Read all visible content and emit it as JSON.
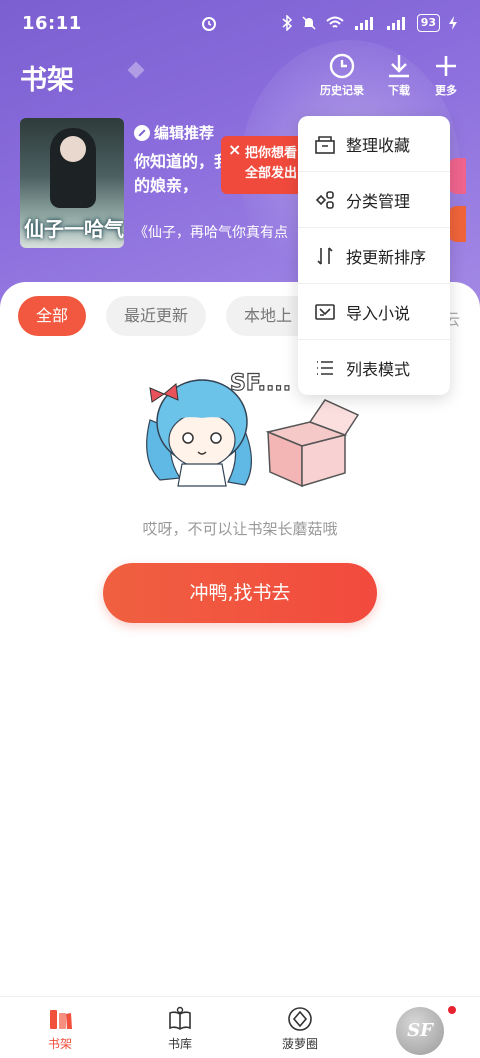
{
  "status": {
    "time": "16:11",
    "battery": "93"
  },
  "header": {
    "title": "书架",
    "buttons": [
      {
        "label": "历史记录",
        "icon": "clock-icon"
      },
      {
        "label": "下载",
        "icon": "download-icon"
      },
      {
        "label": "更多",
        "icon": "plus-icon"
      }
    ]
  },
  "featured": {
    "section_label": "编辑推荐",
    "cover_title": "仙子一哈气",
    "text": "你知道的，我……师姐的娘亲，",
    "quote": "《仙子，再哈气你真有点"
  },
  "tooltip": {
    "close": "×",
    "text": "把你想看\n全部发出"
  },
  "menu": {
    "items": [
      {
        "label": "整理收藏",
        "icon": "organize-icon"
      },
      {
        "label": "分类管理",
        "icon": "category-icon"
      },
      {
        "label": "按更新排序",
        "icon": "sort-icon"
      },
      {
        "label": "导入小说",
        "icon": "import-icon"
      },
      {
        "label": "列表模式",
        "icon": "list-icon"
      }
    ]
  },
  "filters": {
    "chips": [
      "全部",
      "最近更新",
      "本地上"
    ],
    "cut_text": "云"
  },
  "empty": {
    "illustration_text": "SF....",
    "message": "哎呀，不可以让书架长蘑菇哦",
    "cta": "冲鸭,找书去"
  },
  "bottom_nav": {
    "items": [
      {
        "label": "书架",
        "icon": "bookshelf-icon"
      },
      {
        "label": "书库",
        "icon": "library-icon"
      },
      {
        "label": "菠萝圈",
        "icon": "community-icon"
      }
    ],
    "avatar_text": "SF"
  },
  "colors": {
    "accent": "#f1583f",
    "header": "#7b5fd0"
  }
}
